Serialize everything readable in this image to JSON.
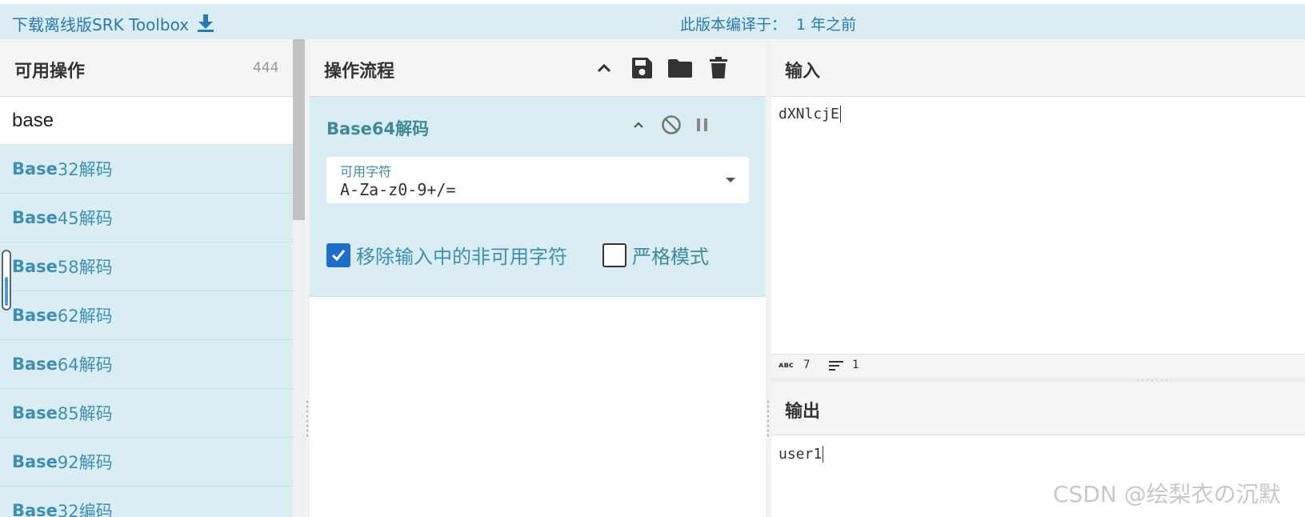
{
  "banner": {
    "download_text": "下载离线版SRK Toolbox",
    "download_icon": "download-icon",
    "build_label": "此版本编译于：",
    "build_value": "1 年之前"
  },
  "operations": {
    "title": "可用操作",
    "count": "444",
    "search_value": "base",
    "items": [
      {
        "match": "Base",
        "rest": "32解码"
      },
      {
        "match": "Base",
        "rest": "45解码"
      },
      {
        "match": "Base",
        "rest": "58解码"
      },
      {
        "match": "Base",
        "rest": "62解码"
      },
      {
        "match": "Base",
        "rest": "64解码"
      },
      {
        "match": "Base",
        "rest": "85解码"
      },
      {
        "match": "Base",
        "rest": "92解码"
      },
      {
        "match": "Base",
        "rest": "32编码"
      }
    ]
  },
  "recipe": {
    "title": "操作流程",
    "header_icons": [
      "chevron-up-icon",
      "save-icon",
      "folder-icon",
      "trash-icon"
    ],
    "operation": {
      "name": "Base64解码",
      "controls": [
        "chevron-up-icon",
        "disable-icon",
        "pause-icon"
      ],
      "alphabet_label": "可用字符",
      "alphabet_value": "A-Za-z0-9+/=",
      "remove_nonalphabet_label": "移除输入中的非可用字符",
      "remove_nonalphabet_checked": true,
      "strict_mode_label": "严格模式",
      "strict_mode_checked": false
    }
  },
  "io": {
    "input_title": "输入",
    "input_value": "dXNlcjE",
    "input_length": "7",
    "input_lines": "1",
    "output_title": "输出",
    "output_value": "user1"
  },
  "watermark": "CSDN @绘梨衣の沉默",
  "colors": {
    "accent_blue": "#2a7ab0",
    "highlight_bg": "#d9edf2",
    "checkbox_blue": "#1e6fc8",
    "op_title_teal": "#3e8a96"
  }
}
